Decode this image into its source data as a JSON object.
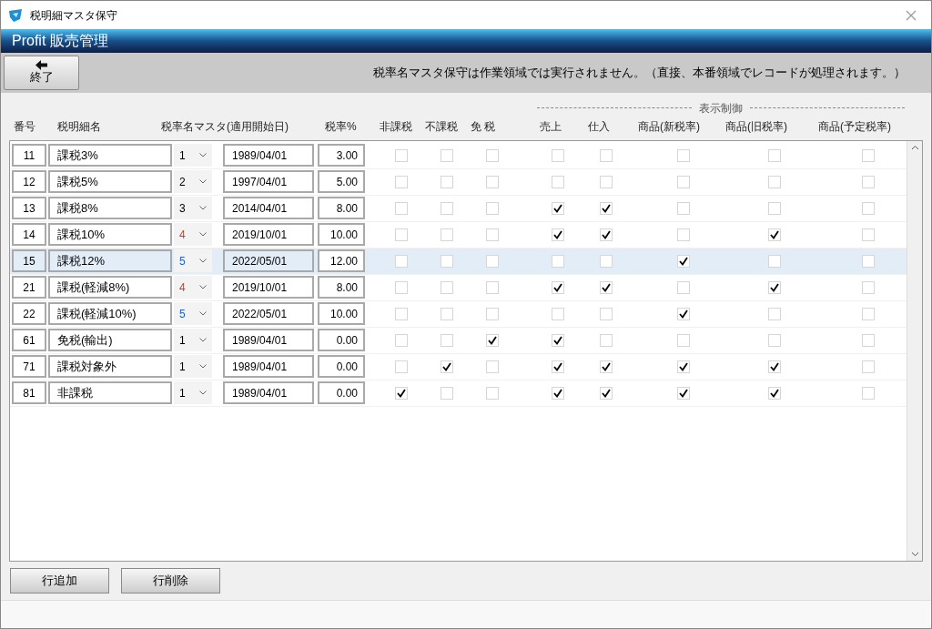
{
  "window": {
    "title": "税明細マスタ保守"
  },
  "banner": {
    "title": "Profit 販売管理"
  },
  "toolbar": {
    "exit_button": {
      "label": "終了"
    },
    "message": "税率名マスタ保守は作業領域では実行されません。（直接、本番領域でレコードが処理されます。）"
  },
  "table": {
    "group_header": "表示制御",
    "columns": [
      "番号",
      "税明細名",
      "税率名マスタ(適用開始日)",
      "税率%",
      "非課税",
      "不課税",
      "免 税",
      "売上",
      "仕入",
      "商品(新税率)",
      "商品(旧税率)",
      "商品(予定税率)"
    ],
    "rows": [
      {
        "no": "11",
        "name": "課税3%",
        "rate_master": {
          "value": "1",
          "color": "#000000"
        },
        "start_date": "1989/04/01",
        "rate": "3.00",
        "checks": [
          false,
          false,
          false,
          false,
          false,
          false,
          false,
          false
        ],
        "selected": false
      },
      {
        "no": "12",
        "name": "課税5%",
        "rate_master": {
          "value": "2",
          "color": "#000000"
        },
        "start_date": "1997/04/01",
        "rate": "5.00",
        "checks": [
          false,
          false,
          false,
          false,
          false,
          false,
          false,
          false
        ],
        "selected": false
      },
      {
        "no": "13",
        "name": "課税8%",
        "rate_master": {
          "value": "3",
          "color": "#000000"
        },
        "start_date": "2014/04/01",
        "rate": "8.00",
        "checks": [
          false,
          false,
          false,
          true,
          true,
          false,
          false,
          false
        ],
        "selected": false
      },
      {
        "no": "14",
        "name": "課税10%",
        "rate_master": {
          "value": "4",
          "color": "#e8321e"
        },
        "start_date": "2019/10/01",
        "rate": "10.00",
        "checks": [
          false,
          false,
          false,
          true,
          true,
          false,
          true,
          false
        ],
        "selected": false
      },
      {
        "no": "15",
        "name": "課税12%",
        "rate_master": {
          "value": "5",
          "color": "#1f5fd0"
        },
        "start_date": "2022/05/01",
        "rate": "12.00",
        "checks": [
          false,
          false,
          false,
          false,
          false,
          true,
          false,
          false
        ],
        "selected": true
      },
      {
        "no": "21",
        "name": "課税(軽減8%)",
        "rate_master": {
          "value": "4",
          "color": "#e8321e"
        },
        "start_date": "2019/10/01",
        "rate": "8.00",
        "checks": [
          false,
          false,
          false,
          true,
          true,
          false,
          true,
          false
        ],
        "selected": false
      },
      {
        "no": "22",
        "name": "課税(軽減10%)",
        "rate_master": {
          "value": "5",
          "color": "#1f5fd0"
        },
        "start_date": "2022/05/01",
        "rate": "10.00",
        "checks": [
          false,
          false,
          false,
          false,
          false,
          true,
          false,
          false
        ],
        "selected": false
      },
      {
        "no": "61",
        "name": "免税(輸出)",
        "rate_master": {
          "value": "1",
          "color": "#000000"
        },
        "start_date": "1989/04/01",
        "rate": "0.00",
        "checks": [
          false,
          false,
          true,
          true,
          false,
          false,
          false,
          false
        ],
        "selected": false
      },
      {
        "no": "71",
        "name": "課税対象外",
        "rate_master": {
          "value": "1",
          "color": "#000000"
        },
        "start_date": "1989/04/01",
        "rate": "0.00",
        "checks": [
          false,
          true,
          false,
          true,
          true,
          true,
          true,
          false
        ],
        "selected": false
      },
      {
        "no": "81",
        "name": "非課税",
        "rate_master": {
          "value": "1",
          "color": "#000000"
        },
        "start_date": "1989/04/01",
        "rate": "0.00",
        "checks": [
          true,
          false,
          false,
          true,
          true,
          true,
          true,
          false
        ],
        "selected": false
      }
    ]
  },
  "buttons": [
    "行追加",
    "行削除"
  ]
}
